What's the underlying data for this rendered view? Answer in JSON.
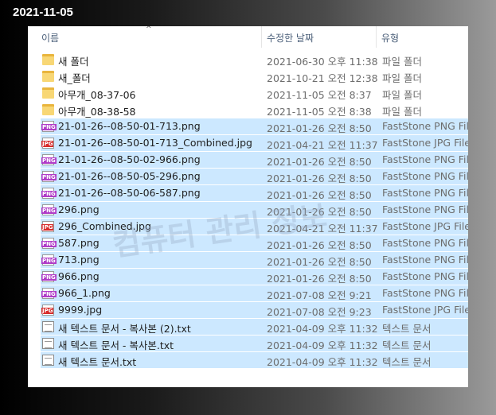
{
  "date_title": "2021-11-05",
  "header": {
    "name": "이름",
    "date": "수정한 날짜",
    "type": "유형"
  },
  "watermark": "컴퓨터 관리 정보",
  "files": [
    {
      "name": "새 폴더",
      "date": "2021-06-30 오후 11:38",
      "type": "파일 폴더",
      "icon": "folder-icon",
      "selected": false
    },
    {
      "name": "새_폴더",
      "date": "2021-10-21 오전 12:38",
      "type": "파일 폴더",
      "icon": "folder-icon",
      "selected": false
    },
    {
      "name": "아무개_08-37-06",
      "date": "2021-11-05 오전 8:37",
      "type": "파일 폴더",
      "icon": "folder-icon",
      "selected": false
    },
    {
      "name": "아무개_08-38-58",
      "date": "2021-11-05 오전 8:38",
      "type": "파일 폴더",
      "icon": "folder-icon",
      "selected": false
    },
    {
      "name": "21-01-26--08-50-01-713.png",
      "date": "2021-01-26 오전 8:50",
      "type": "FastStone PNG File",
      "icon": "png-icon",
      "selected": true
    },
    {
      "name": "21-01-26--08-50-01-713_Combined.jpg",
      "date": "2021-04-21 오전 11:37",
      "type": "FastStone JPG File",
      "icon": "jpg-icon",
      "selected": true
    },
    {
      "name": "21-01-26--08-50-02-966.png",
      "date": "2021-01-26 오전 8:50",
      "type": "FastStone PNG File",
      "icon": "png-icon",
      "selected": true
    },
    {
      "name": "21-01-26--08-50-05-296.png",
      "date": "2021-01-26 오전 8:50",
      "type": "FastStone PNG File",
      "icon": "png-icon",
      "selected": true
    },
    {
      "name": "21-01-26--08-50-06-587.png",
      "date": "2021-01-26 오전 8:50",
      "type": "FastStone PNG File",
      "icon": "png-icon",
      "selected": true
    },
    {
      "name": "296.png",
      "date": "2021-01-26 오전 8:50",
      "type": "FastStone PNG File",
      "icon": "png-icon",
      "selected": true
    },
    {
      "name": "296_Combined.jpg",
      "date": "2021-04-21 오전 11:37",
      "type": "FastStone JPG File",
      "icon": "jpg-icon",
      "selected": true
    },
    {
      "name": "587.png",
      "date": "2021-01-26 오전 8:50",
      "type": "FastStone PNG File",
      "icon": "png-icon",
      "selected": true
    },
    {
      "name": "713.png",
      "date": "2021-01-26 오전 8:50",
      "type": "FastStone PNG File",
      "icon": "png-icon",
      "selected": true
    },
    {
      "name": "966.png",
      "date": "2021-01-26 오전 8:50",
      "type": "FastStone PNG File",
      "icon": "png-icon",
      "selected": true
    },
    {
      "name": "966_1.png",
      "date": "2021-07-08 오전 9:21",
      "type": "FastStone PNG File",
      "icon": "png-icon",
      "selected": true
    },
    {
      "name": "9999.jpg",
      "date": "2021-07-08 오전 9:23",
      "type": "FastStone JPG File",
      "icon": "jpg-icon",
      "selected": true
    },
    {
      "name": "새 텍스트 문서 - 복사본 (2).txt",
      "date": "2021-04-09 오후 11:32",
      "type": "텍스트 문서",
      "icon": "text-file-icon",
      "selected": true
    },
    {
      "name": "새 텍스트 문서 - 복사본.txt",
      "date": "2021-04-09 오후 11:32",
      "type": "텍스트 문서",
      "icon": "text-file-icon",
      "selected": true
    },
    {
      "name": "새 텍스트 문서.txt",
      "date": "2021-04-09 오후 11:32",
      "type": "텍스트 문서",
      "icon": "text-file-icon",
      "selected": true
    }
  ]
}
